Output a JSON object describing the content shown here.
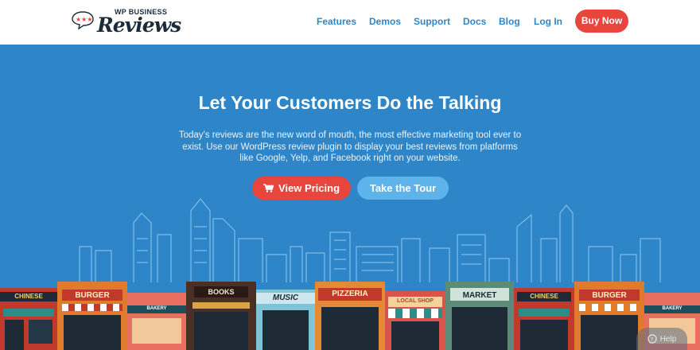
{
  "header": {
    "logo": {
      "top_text": "WP BUSINESS",
      "main_text": "Reviews"
    },
    "nav": [
      {
        "label": "Features"
      },
      {
        "label": "Demos"
      },
      {
        "label": "Support"
      },
      {
        "label": "Docs"
      },
      {
        "label": "Blog"
      },
      {
        "label": "Log In"
      }
    ],
    "buy_label": "Buy Now"
  },
  "hero": {
    "title": "Let Your Customers Do the Talking",
    "subtitle": "Today's reviews are the new word of mouth, the most effective marketing tool ever to exist. Use our WordPress review plugin to display your best reviews from platforms like Google, Yelp, and Facebook right on your website.",
    "pricing_label": "View Pricing",
    "tour_label": "Take the Tour"
  },
  "storefronts": [
    {
      "sign": "CHINESE"
    },
    {
      "sign": "BURGER"
    },
    {
      "sign": "BAKERY"
    },
    {
      "sign": "BOOKS"
    },
    {
      "sign": "MUSIC"
    },
    {
      "sign": "PIZZERIA"
    },
    {
      "sign": "LOCAL SHOP"
    },
    {
      "sign": "MARKET"
    },
    {
      "sign": "CHINESE"
    },
    {
      "sign": "BURGER"
    },
    {
      "sign": "BAKERY"
    }
  ],
  "help_label": "Help",
  "colors": {
    "brand_blue": "#2e86c9",
    "accent_red": "#e8453c",
    "light_blue_button": "#5eb3ea",
    "logo_navy": "#1c2b3a"
  }
}
